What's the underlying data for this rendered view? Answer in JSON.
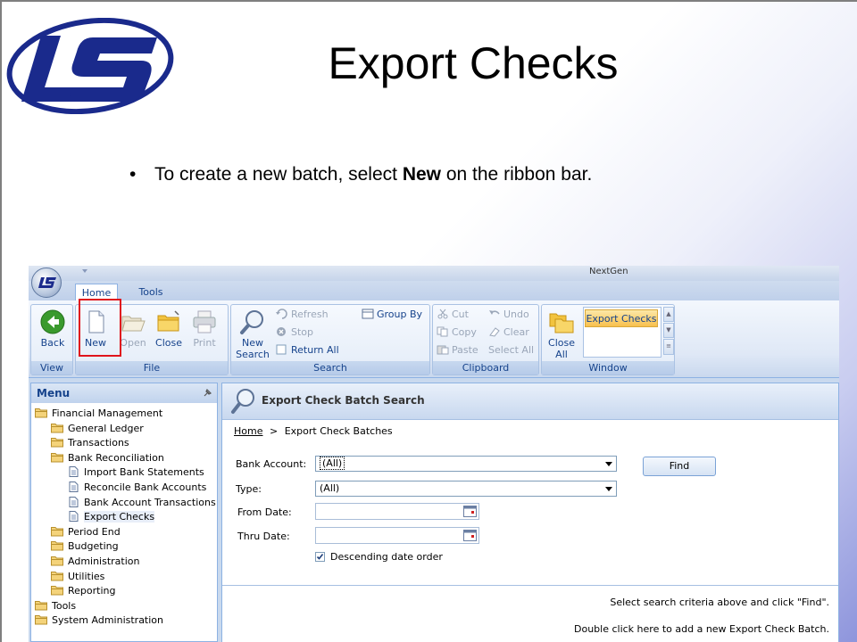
{
  "slide": {
    "title": "Export Checks",
    "bullet_pre": "To create a new batch, select ",
    "bullet_bold": "New",
    "bullet_post": " on the ribbon bar.",
    "bullet_glyph": "•"
  },
  "app": {
    "window_title": "NextGen",
    "tabs": [
      {
        "label": "Home"
      },
      {
        "label": "Tools"
      }
    ],
    "ribbon": {
      "view": {
        "label": "View",
        "back": "Back"
      },
      "file": {
        "label": "File",
        "new": "New",
        "open": "Open",
        "close": "Close",
        "print": "Print"
      },
      "search": {
        "label": "Search",
        "new_search_1": "New",
        "new_search_2": "Search",
        "refresh": "Refresh",
        "stop": "Stop",
        "return_all": "Return All",
        "group_by": "Group By"
      },
      "clipboard": {
        "label": "Clipboard",
        "cut": "Cut",
        "copy": "Copy",
        "paste": "Paste",
        "undo": "Undo",
        "clear": "Clear",
        "select_all": "Select All"
      },
      "window": {
        "label": "Window",
        "close_all_1": "Close",
        "close_all_2": "All",
        "active_window": "Export Checks"
      }
    },
    "menu": {
      "title": "Menu",
      "items": [
        {
          "label": "Financial Management",
          "kind": "folder"
        },
        {
          "label": "General Ledger",
          "kind": "folder"
        },
        {
          "label": "Transactions",
          "kind": "folder"
        },
        {
          "label": "Bank Reconciliation",
          "kind": "folder"
        },
        {
          "label": "Import Bank Statements",
          "kind": "page"
        },
        {
          "label": "Reconcile Bank Accounts",
          "kind": "page"
        },
        {
          "label": "Bank Account Transactions",
          "kind": "page"
        },
        {
          "label": "Export Checks",
          "kind": "page"
        },
        {
          "label": "Period End",
          "kind": "folder"
        },
        {
          "label": "Budgeting",
          "kind": "folder"
        },
        {
          "label": "Administration",
          "kind": "folder"
        },
        {
          "label": "Utilities",
          "kind": "folder"
        },
        {
          "label": "Reporting",
          "kind": "folder"
        },
        {
          "label": "Tools",
          "kind": "folder"
        },
        {
          "label": "System Administration",
          "kind": "folder"
        }
      ]
    },
    "content": {
      "title": "Export Check Batch Search",
      "breadcrumb_home": "Home",
      "breadcrumb_sep": ">",
      "breadcrumb_current": "Export Check Batches",
      "bank_account_label": "Bank Account:",
      "bank_account_value": "(All)",
      "type_label": "Type:",
      "type_value": "(All)",
      "from_date_label": "From Date:",
      "thru_date_label": "Thru Date:",
      "find_label": "Find",
      "descending_label": "Descending date order",
      "descending_checked": true,
      "msg_select": "Select search criteria above and click \"Find\".",
      "msg_add": "Double click here to add a new Export Check Batch."
    }
  },
  "colors": {
    "ribbon_text": "#15428b",
    "highlight": "#e0141c",
    "logo": "#1a2a8c"
  }
}
